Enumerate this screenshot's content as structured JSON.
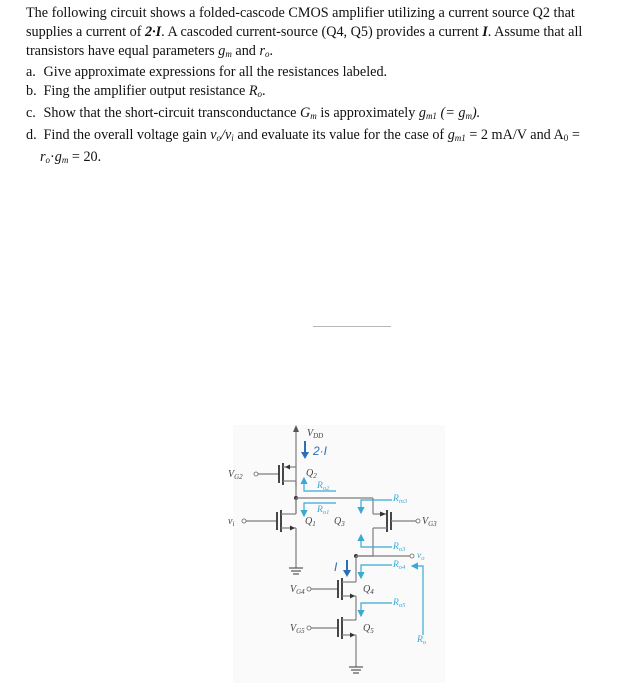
{
  "problem": {
    "intro_1": "The following circuit shows a folded-cascode CMOS amplifier utilizing a current source Q2 that supplies a current of ",
    "intro_bold_1": "2·I",
    "intro_2": ". A cascoded current-source (Q4, Q5) provides a current ",
    "intro_bold_2": "I",
    "intro_3": ". Assume that all transistors have equal parameters ",
    "param_gm": "g",
    "param_gm_sub": "m",
    "intro_and": " and ",
    "param_ro": "r",
    "param_ro_sub": "o",
    "intro_end": ".",
    "items": [
      {
        "label": "a.",
        "text": "Give approximate expressions for all the resistances labeled."
      },
      {
        "label": "b.",
        "text": "Fing the amplifier output resistance ",
        "sym": "R",
        "sym_sub": "o",
        "tail": "."
      },
      {
        "label": "c.",
        "text": "Show that the short-circuit transconductance ",
        "sym": "G",
        "sym_sub": "m",
        "mid": " is approximately ",
        "sym2": "g",
        "sym2_sub": "m1",
        "tail": " (= g",
        "tail_sub": "m",
        "tail_end": ")."
      },
      {
        "label": "d.",
        "text": "Find the overall voltage gain ",
        "ratio": "v",
        "ratio_sub_o": "o",
        "ratio_slash": "/v",
        "ratio_sub_i": "i",
        "mid": " and evaluate its value for the case of ",
        "sym": "g",
        "sym_sub": "m1",
        "val1": " = 2 mA/V and A",
        "a_sub": "0",
        "val2": " =",
        "line2_a": "r",
        "line2_a_sub": "o",
        "line2_dot": "·",
        "line2_b": "g",
        "line2_b_sub": "m",
        "line2_val": " = 20."
      }
    ]
  },
  "circuit": {
    "vdd": "V",
    "vdd_sub": "DD",
    "current_top": "2·I",
    "current_bottom": "I",
    "q1": "Q",
    "q1_sub": "1",
    "q2": "Q",
    "q2_sub": "2",
    "q3": "Q",
    "q3_sub": "3",
    "q4": "Q",
    "q4_sub": "4",
    "q5": "Q",
    "q5_sub": "5",
    "vg2": "V",
    "vg2_sub": "G2",
    "vg3": "V",
    "vg3_sub": "G3",
    "vg4": "V",
    "vg4_sub": "G4",
    "vg5": "V",
    "vg5_sub": "G5",
    "vi": "v",
    "vi_sub": "i",
    "vo": "v",
    "vo_sub": "o",
    "ro1": "R",
    "ro1_sub": "o1",
    "ro2": "R",
    "ro2_sub": "o2",
    "ro3": "R",
    "ro3_sub": "o3",
    "ro4": "R",
    "ro4_sub": "o4",
    "ro5": "R",
    "ro5_sub": "o5",
    "rin3": "R",
    "rin3_sub": "in3",
    "ro": "R",
    "ro_sub": "o"
  }
}
